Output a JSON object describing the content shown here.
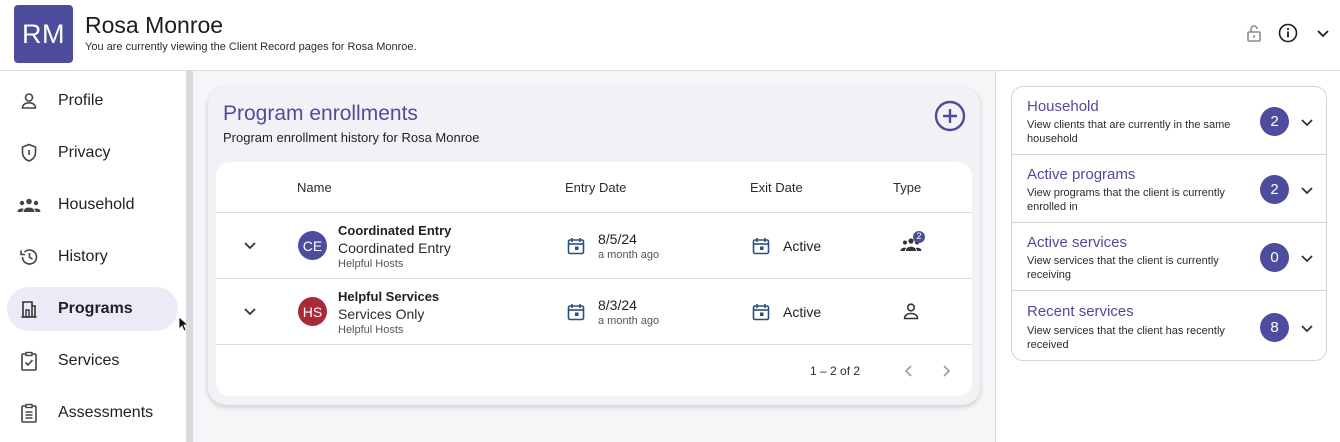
{
  "header": {
    "initials": "RM",
    "name": "Rosa Monroe",
    "subtitle": "You are currently viewing the Client Record pages for Rosa Monroe.",
    "icons": [
      "lock-icon",
      "info-icon",
      "chevron-down-icon"
    ]
  },
  "sidebar": {
    "items": [
      {
        "label": "Profile",
        "icon": "person-icon"
      },
      {
        "label": "Privacy",
        "icon": "shield-icon"
      },
      {
        "label": "Household",
        "icon": "group-icon"
      },
      {
        "label": "History",
        "icon": "history-icon"
      },
      {
        "label": "Programs",
        "icon": "building-icon",
        "active": true
      },
      {
        "label": "Services",
        "icon": "clipboard-check-icon"
      },
      {
        "label": "Assessments",
        "icon": "clipboard-list-icon"
      }
    ]
  },
  "enrollments": {
    "title": "Program enrollments",
    "subtitle": "Program enrollment history for Rosa Monroe",
    "columns": {
      "name": "Name",
      "entry": "Entry Date",
      "exit": "Exit Date",
      "type": "Type"
    },
    "rows": [
      {
        "initials": "CE",
        "avatar_color": "#4e4c9c",
        "program": "Coordinated Entry",
        "project": "Coordinated Entry",
        "org": "Helpful Hosts",
        "entry_date": "8/5/24",
        "entry_ago": "a month ago",
        "exit": "Active",
        "type_icon": "household-icon",
        "type_badge": "2"
      },
      {
        "initials": "HS",
        "avatar_color": "#a82a3a",
        "program": "Helpful Services",
        "project": "Services Only",
        "org": "Helpful Hosts",
        "entry_date": "8/3/24",
        "entry_ago": "a month ago",
        "exit": "Active",
        "type_icon": "person-icon",
        "type_badge": ""
      }
    ],
    "pager": "1 – 2 of 2"
  },
  "panels": [
    {
      "title": "Household",
      "desc": "View clients that are currently in the same household",
      "count": "2"
    },
    {
      "title": "Active programs",
      "desc": "View programs that the client is currently enrolled in",
      "count": "2"
    },
    {
      "title": "Active services",
      "desc": "View services that the client is currently receiving",
      "count": "0"
    },
    {
      "title": "Recent services",
      "desc": "View services that the client has recently received",
      "count": "8"
    }
  ],
  "colors": {
    "brand": "#4e4c9c",
    "active_nav_bg": "#eceaf6",
    "hs_avatar": "#a82a3a"
  }
}
